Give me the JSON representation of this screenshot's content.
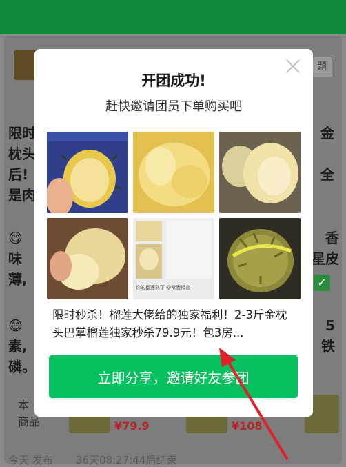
{
  "background": {
    "paragraph1": [
      "限时",
      "枕头",
      "后!",
      "是肉"
    ],
    "paragraph1_right": [
      "金",
      "",
      "全",
      ""
    ],
    "paragraph2": [
      "😋",
      "味",
      "薄,"
    ],
    "paragraph2_right": [
      "香",
      "星皮",
      ""
    ],
    "paragraph3": [
      "😄",
      "素,",
      "磷。"
    ],
    "paragraph3_right": [
      "5",
      "铁",
      ""
    ],
    "goods_label": "本\n商品",
    "price1": "¥79.9",
    "price2": "¥108",
    "footer": "今天 发布",
    "footer_timer": "36天08:27:44后结束",
    "side_button_text": "题"
  },
  "modal": {
    "title": "开团成功!",
    "subtitle": "赶快邀请团员下单购买吧",
    "description": "限时秒杀！榴莲大佬给的独家福利！2-3斤金枕头巴掌榴莲独家秒杀79.9元！包3房...",
    "share_button": "立即分享，邀请好友参团",
    "screenshot_caption": "你的榴莲熟了 @常香榴恋"
  },
  "photos": [
    {
      "name": "durian-photo-1",
      "colors": [
        "#2d3f8e",
        "#f0d26a"
      ]
    },
    {
      "name": "durian-photo-2",
      "colors": [
        "#e9cf58",
        "#f4e08c"
      ]
    },
    {
      "name": "durian-photo-3",
      "colors": [
        "#8b7a5a",
        "#f2e3a6"
      ]
    },
    {
      "name": "durian-photo-4",
      "colors": [
        "#7b5a3a",
        "#f1df9b"
      ]
    },
    {
      "name": "durian-photo-5",
      "colors": [
        "#e8e8e8",
        "#f3d889"
      ]
    },
    {
      "name": "durian-photo-6",
      "colors": [
        "#3d3a2e",
        "#9a9a3a"
      ]
    }
  ]
}
